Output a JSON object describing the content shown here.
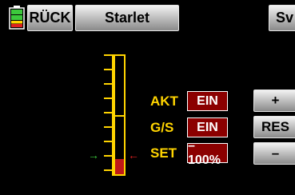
{
  "header": {
    "back_label": "RÜCK",
    "title": "Starlet",
    "save_label": "Sv"
  },
  "rows": [
    {
      "label": "AKT",
      "value": "EIN"
    },
    {
      "label": "G/S",
      "value": "EIN"
    },
    {
      "label": "SET",
      "value": "–100%"
    }
  ],
  "side_buttons": {
    "plus": "+",
    "reset": "RES",
    "minus": "–"
  },
  "gauge": {
    "current_level_fraction": 0.13
  },
  "colors": {
    "accent": "#ffd400",
    "value_bg": "#8b0000",
    "marker_left": "#3cc83c",
    "marker_right": "#e02020"
  },
  "icons": {
    "battery": "battery-icon"
  }
}
